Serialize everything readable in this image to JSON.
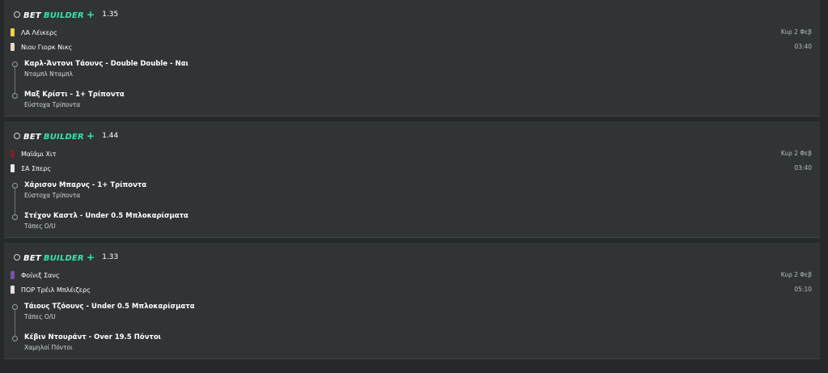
{
  "brand": {
    "word1": "BET",
    "word2": "BUILDER",
    "plus": "+"
  },
  "colors": {
    "accent": "#35e3b0",
    "card_bg": "#303434",
    "page_bg": "#262929"
  },
  "cards": [
    {
      "odds": "1.35",
      "team1": {
        "name": "ΛΑ Λέικερς",
        "kit_color": "#f4d03f"
      },
      "team2": {
        "name": "Νιου Γιορκ Νικς",
        "kit_color": "#e8d7c5"
      },
      "date": "Κυρ 2 Φεβ",
      "time": "03:40",
      "selections": [
        {
          "title": "Καρλ-Άντονι Τάουνς - Double Double - Ναι",
          "market": "Νταμπλ Νταμπλ"
        },
        {
          "title": "Μαξ Κρίστι - 1+ Τρίποντα",
          "market": "Εύστοχα Τρίποντα"
        }
      ]
    },
    {
      "odds": "1.44",
      "team1": {
        "name": "Μαϊάμι Χιτ",
        "kit_color": "#7a1f2b"
      },
      "team2": {
        "name": "ΣΑ Σπερς",
        "kit_color": "#e6e6e6"
      },
      "date": "Κυρ 2 Φεβ",
      "time": "03:40",
      "selections": [
        {
          "title": "Χάρισον Μπαρνς - 1+ Τρίποντα",
          "market": "Εύστοχα Τρίποντα"
        },
        {
          "title": "Στέχον Καστλ - Under 0.5 Μπλοκαρίσματα",
          "market": "Τάπες O/U"
        }
      ]
    },
    {
      "odds": "1.33",
      "team1": {
        "name": "Φοίνιξ Σανς",
        "kit_color": "#7b4fa8"
      },
      "team2": {
        "name": "ΠΟΡ Τρέιλ Μπλέιζερς",
        "kit_color": "#e9dcdc"
      },
      "date": "Κυρ 2 Φεβ",
      "time": "05:10",
      "selections": [
        {
          "title": "Τάιους Τζόουνς - Under 0.5 Μπλοκαρίσματα",
          "market": "Τάπες O/U"
        },
        {
          "title": "Κέβιν Ντουράντ - Over 19.5 Πόντοι",
          "market": "Χαμηλοί Πόντοι"
        }
      ]
    }
  ]
}
